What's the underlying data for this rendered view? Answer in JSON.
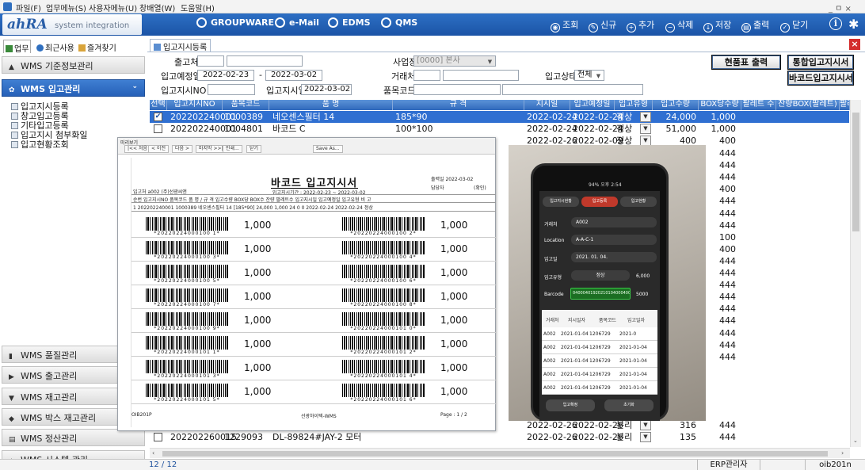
{
  "menubar": {
    "items": [
      "파일(F)",
      "업무메뉴(S)",
      "사용자메뉴(U)",
      "창배열(W)",
      "도움말(H)"
    ],
    "window_controls": "_ ㅁ ×"
  },
  "topbar": {
    "logo_main": "ahRA",
    "logo_sub": "system integration",
    "systems": [
      "GROUPWARE",
      "e-Mail",
      "EDMS",
      "QMS"
    ],
    "actions": [
      "조회",
      "신규",
      "추가",
      "삭제",
      "저장",
      "출력",
      "닫기"
    ]
  },
  "left_tabs": [
    "업무",
    "최근사용",
    "즐겨찾기"
  ],
  "sidebar": {
    "sections_top": [
      "WMS 기준정보관리",
      "WMS 입고관리"
    ],
    "tree_items": [
      "입고지시등록",
      "창고입고등록",
      "기타입고등록",
      "입고지시 첨부화일",
      "입고현황조회"
    ],
    "sections_bottom": [
      "WMS 품질관리",
      "WMS 출고관리",
      "WMS 재고관리",
      "WMS 박스 재고관리",
      "WMS 정산관리",
      "WMS 시스템 관리"
    ]
  },
  "doc_tab": "입고지시등록",
  "form": {
    "label_source": "출고처",
    "label_plan_date": "입고예정일",
    "date_from": "2022-02-23",
    "date_sep": "-",
    "date_to": "2022-03-02",
    "label_order_no": "입고지시NO",
    "label_order_date": "입고지시일",
    "order_date": "2022-03-02",
    "label_site": "사업장",
    "site_value": "[0000] 본사",
    "label_partner": "거래처",
    "label_status": "입고상태",
    "status_value": "전체",
    "label_item_code": "품목코드",
    "btn_site_print": "현품표 출력",
    "btn_combined_order": "통합입고지시서",
    "btn_barcode_order": "바코드입고지시서"
  },
  "grid": {
    "headers": [
      "선택",
      "입고지시NO",
      "품목코드",
      "품 명",
      "규 격",
      "지시일",
      "입고예정일",
      "입고유형",
      "입고수량",
      "BOX당수량",
      "팔레트 수",
      "잔량BOX(팔레트)",
      "팔레"
    ],
    "rows": [
      {
        "checked": true,
        "order_no": "202202240001",
        "item_code": "1000389",
        "name": "네오센스필터 14",
        "spec": "185*90",
        "order_date": "2022-02-24",
        "plan_date": "2022-02-24",
        "type": "정상",
        "qty": "24,000",
        "box_qty": "1,000"
      },
      {
        "checked": false,
        "order_no": "202202240001",
        "item_code": "1004801",
        "name": "바코드 C",
        "spec": "100*100",
        "order_date": "2022-02-24",
        "plan_date": "2022-02-24",
        "type": "정상",
        "qty": "51,000",
        "box_qty": "1,000"
      },
      {
        "checked": null,
        "order_no": "",
        "item_code": "",
        "name": "",
        "spec": "",
        "order_date": "2022-02-26",
        "plan_date": "2022-02-09",
        "type": "정상",
        "qty": "400",
        "box_qty": "400"
      }
    ],
    "box_qty_column": [
      "444",
      "444",
      "444",
      "400",
      "444",
      "444",
      "444",
      "100",
      "400",
      "444",
      "444",
      "444",
      "444",
      "444",
      "444",
      "444",
      "444",
      "444"
    ],
    "row_partial_a": {
      "order_date": "2022-02-26",
      "plan_date": "2022-02-26",
      "type": "분리",
      "qty": "316",
      "box_qty": "444"
    },
    "row_last": {
      "order_no": "202202260015",
      "item_code": "1229093",
      "name": "DL-89824#JAY-2 모터",
      "order_date": "2022-02-26",
      "plan_date": "2022-02-26",
      "type": "분리",
      "qty": "135",
      "box_qty": "444"
    }
  },
  "statusbar": {
    "count": "12 / 12",
    "user": "ERP관리자",
    "screen_id": "oib201n"
  },
  "report": {
    "window_title": "미리보기",
    "toolbar": [
      "|<< 처음",
      "< 이전",
      "다음 >",
      "마지막 >>|",
      "인쇄...",
      "닫기",
      "Save As..."
    ],
    "title": "바코드 입고지시서",
    "date_label": "출력일 2022-03-02",
    "manager_label": "담당자",
    "confirm_label": "(확인)",
    "period": "입고지시기간 : 2022-02-23 ~ 2022-03-02",
    "source_line": "입고처 a002 (주)선광씨앤",
    "table_header": "순번  입고지시NO   품목코드        품 명 / 규 격       입고수량  BOX당  BOX수  잔량 팔레트수  입고지시일  입고예정일  입고유형   비 고",
    "table_row": "1  202202240001  1000389     네오센스필터 14 [185*90]     24,000  1,000   24     0   0  2022-02-24  2022-02-24  정상",
    "barcodes": [
      {
        "code": "*20220224000100 1*",
        "qty": "1,000"
      },
      {
        "code": "*20220224000100 2*",
        "qty": "1,000"
      },
      {
        "code": "*20220224000100 3*",
        "qty": "1,000"
      },
      {
        "code": "*20220224000100 4*",
        "qty": "1,000"
      },
      {
        "code": "*20220224000100 5*",
        "qty": "1,000"
      },
      {
        "code": "*20220224000100 6*",
        "qty": "1,000"
      },
      {
        "code": "*20220224000100 7*",
        "qty": "1,000"
      },
      {
        "code": "*20220224000100 8*",
        "qty": "1,000"
      },
      {
        "code": "*20220224000100 9*",
        "qty": "1,000"
      },
      {
        "code": "*20220224000101 0*",
        "qty": "1,000"
      },
      {
        "code": "*20220224000101 1*",
        "qty": "1,000"
      },
      {
        "code": "*20220224000101 2*",
        "qty": "1,000"
      },
      {
        "code": "*20220224000101 3*",
        "qty": "1,000"
      },
      {
        "code": "*20220224000101 4*",
        "qty": "1,000"
      },
      {
        "code": "*20220224000101 5*",
        "qty": "1,000"
      },
      {
        "code": "*20220224000101 6*",
        "qty": "1,000"
      }
    ],
    "footer_left": "OIB201P",
    "footer_center": "선광하이텍-WMS",
    "footer_right": "Page : 1 / 2"
  },
  "phone": {
    "status": "94% 오후 2:54",
    "tabs": [
      "입고지시현황",
      "입고등록",
      "입고현황"
    ],
    "fields": [
      {
        "label": "거래처",
        "value": "A002"
      },
      {
        "label": "Location",
        "value": "A-A-C-1"
      },
      {
        "label": "입고일",
        "value": "2021. 01. 04."
      },
      {
        "label": "입고유형",
        "value": "정상",
        "extra": "6,000"
      },
      {
        "label": "Barcode",
        "value": "0400040192021010400040000",
        "extra": "5000"
      }
    ],
    "table_headers": [
      "거래처",
      "지시일자",
      "품목코드",
      "입고일자"
    ],
    "table_rows": [
      [
        "A002",
        "2021-01-04",
        "1206729",
        "2021-0"
      ],
      [
        "A002",
        "2021-01-04",
        "1206729",
        "2021-01-04"
      ],
      [
        "A002",
        "2021-01-04",
        "1206729",
        "2021-01-04"
      ],
      [
        "A002",
        "2021-01-04",
        "1206729",
        "2021-01-04"
      ],
      [
        "A002",
        "2021-01-04",
        "1206729",
        "2021-01-04"
      ]
    ],
    "buttons": [
      "입고확정",
      "초기화"
    ]
  }
}
